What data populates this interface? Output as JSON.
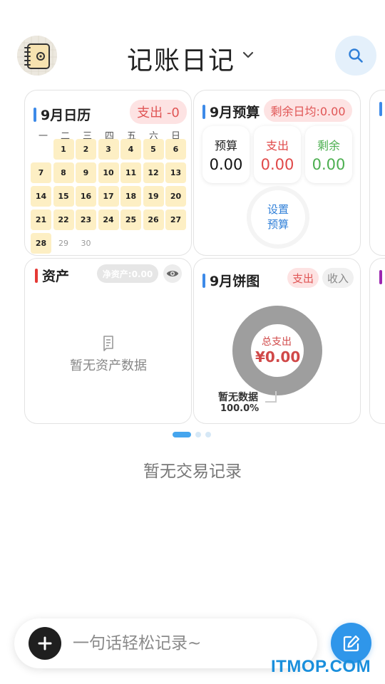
{
  "header": {
    "title": "记账日记",
    "avatar_icon": "notebook-avatar-icon",
    "chevron_icon": "chevron-down-icon",
    "search_icon": "search-icon"
  },
  "calendar_card": {
    "title": "9月日历",
    "accent": "#3d8ae8",
    "expense_badge": "支出 -0",
    "weekdays": [
      "一",
      "二",
      "三",
      "四",
      "五",
      "六",
      "日"
    ],
    "days": [
      {
        "label": "",
        "state": "blank"
      },
      {
        "label": "1",
        "state": "filled"
      },
      {
        "label": "2",
        "state": "filled"
      },
      {
        "label": "3",
        "state": "filled"
      },
      {
        "label": "4",
        "state": "filled"
      },
      {
        "label": "5",
        "state": "filled"
      },
      {
        "label": "6",
        "state": "filled"
      },
      {
        "label": "7",
        "state": "filled"
      },
      {
        "label": "8",
        "state": "filled"
      },
      {
        "label": "9",
        "state": "filled"
      },
      {
        "label": "10",
        "state": "filled"
      },
      {
        "label": "11",
        "state": "filled"
      },
      {
        "label": "12",
        "state": "filled"
      },
      {
        "label": "13",
        "state": "filled"
      },
      {
        "label": "14",
        "state": "filled"
      },
      {
        "label": "15",
        "state": "filled"
      },
      {
        "label": "16",
        "state": "filled"
      },
      {
        "label": "17",
        "state": "filled"
      },
      {
        "label": "18",
        "state": "filled"
      },
      {
        "label": "19",
        "state": "filled"
      },
      {
        "label": "20",
        "state": "filled"
      },
      {
        "label": "21",
        "state": "filled"
      },
      {
        "label": "22",
        "state": "filled"
      },
      {
        "label": "23",
        "state": "filled"
      },
      {
        "label": "24",
        "state": "filled"
      },
      {
        "label": "25",
        "state": "filled"
      },
      {
        "label": "26",
        "state": "filled"
      },
      {
        "label": "27",
        "state": "filled"
      },
      {
        "label": "28",
        "state": "filled"
      },
      {
        "label": "29",
        "state": "future"
      },
      {
        "label": "30",
        "state": "future"
      }
    ]
  },
  "budget_card": {
    "title": "9月预算",
    "accent": "#3d8ae8",
    "daily_badge": "剩余日均:0.00",
    "budget_label": "预算",
    "budget_value": "0.00",
    "expense_label": "支出",
    "expense_value": "0.00",
    "remaining_label": "剩余",
    "remaining_value": "0.00",
    "set_budget_line1": "设置",
    "set_budget_line2": "预算"
  },
  "assets_card": {
    "title": "资产",
    "accent": "#e53935",
    "net_assets_badge": "净资产:0.00",
    "eye_icon": "eye-icon",
    "empty_icon": "document-icon",
    "empty_text": "暂无资产数据"
  },
  "pie_card": {
    "title": "9月饼图",
    "accent": "#3d8ae8",
    "tab_expense": "支出",
    "tab_income": "收入",
    "center_label": "总支出",
    "center_value": "¥0.00",
    "no_data_label": "暂无数据",
    "no_data_percent": "100.0%"
  },
  "pager": {
    "active_index": 0,
    "count": 3
  },
  "transactions": {
    "empty_text": "暂无交易记录"
  },
  "quick_entry": {
    "add_icon": "plus-icon",
    "placeholder": "一句话轻松记录~",
    "edit_icon": "edit-icon"
  },
  "watermark": "ITMOP.COM",
  "colors": {
    "primary_blue": "#2f96ea",
    "expense_red": "#e04848",
    "income_green": "#4caf50",
    "calendar_fill": "#fdefc4"
  }
}
